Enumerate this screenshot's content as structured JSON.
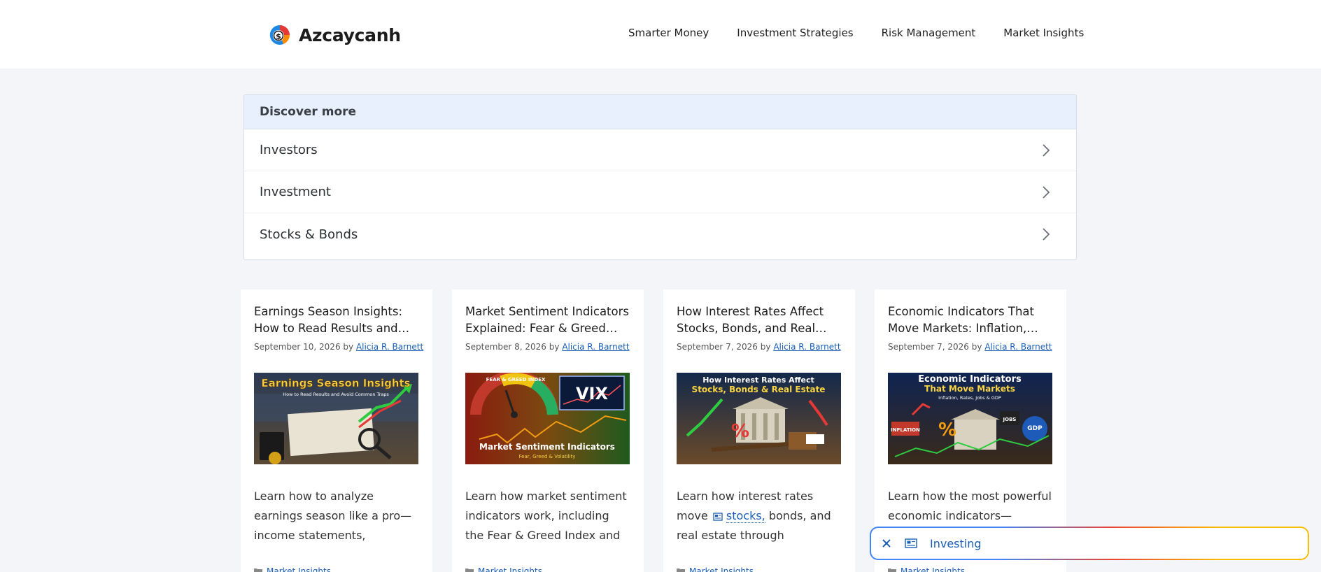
{
  "site": {
    "name": "Azcaycanh"
  },
  "nav": [
    {
      "label": "Smarter Money"
    },
    {
      "label": "Investment Strategies"
    },
    {
      "label": "Risk Management"
    },
    {
      "label": "Market Insights"
    }
  ],
  "discover": {
    "title": "Discover more",
    "items": [
      {
        "label": "Investors"
      },
      {
        "label": "Investment"
      },
      {
        "label": "Stocks & Bonds"
      }
    ]
  },
  "cards": [
    {
      "title": "Earnings Season Insights: How to Read Results and Avoid Common Traps",
      "date": "September 10, 2026",
      "by": "by",
      "author": "Alicia R. Barnett",
      "image_title": "Earnings Season Insights",
      "image_subtitle": "How to Read Results and Avoid Common Traps",
      "excerpt": "Learn how to analyze earnings season like a pro—income statements, guidance, margins,...",
      "category": "Market Insights"
    },
    {
      "title": "Market Sentiment Indicators Explained: Fear & Greed Index and VIX",
      "date": "September 8, 2026",
      "by": "by",
      "author": "Alicia R. Barnett",
      "image_title": "Market Sentiment Indicators",
      "image_subtitle": "Fear, Greed & Volatility",
      "image_badge": "VIX",
      "image_gauge": "FEAR & GREED INDEX",
      "excerpt": "Learn how market sentiment indicators work, including the Fear & Greed Index and the VI...",
      "category": "Market Insights"
    },
    {
      "title": "How Interest Rates Affect Stocks, Bonds, and Real Estate",
      "date": "September 7, 2026",
      "by": "by",
      "author": "Alicia R. Barnett",
      "image_title": "How Interest Rates Affect",
      "image_subtitle": "Stocks, Bonds & Real Estate",
      "excerpt_pre": "Learn how interest rates move",
      "excerpt_kw": "stocks,",
      "excerpt_post": " bonds, and real estate through valuations, yields,...",
      "category": "Market Insights"
    },
    {
      "title": "Economic Indicators That Move Markets: Inflation, Rates, Jobs & GDP",
      "date": "September 7, 2026",
      "by": "by",
      "author": "Alicia R. Barnett",
      "image_title": "Economic Indicators",
      "image_subtitle": "That Move Markets",
      "image_caption": "Inflation, Rates, Jobs & GDP",
      "excerpt": "Learn how the most powerful economic indicators— inflation,",
      "category": "Market Insights"
    }
  ],
  "floatbar": {
    "label": "Investing"
  },
  "colors": {
    "link": "#1a5fb4",
    "discover_head": "#e8f0fd",
    "background": "#f3f5f8"
  }
}
